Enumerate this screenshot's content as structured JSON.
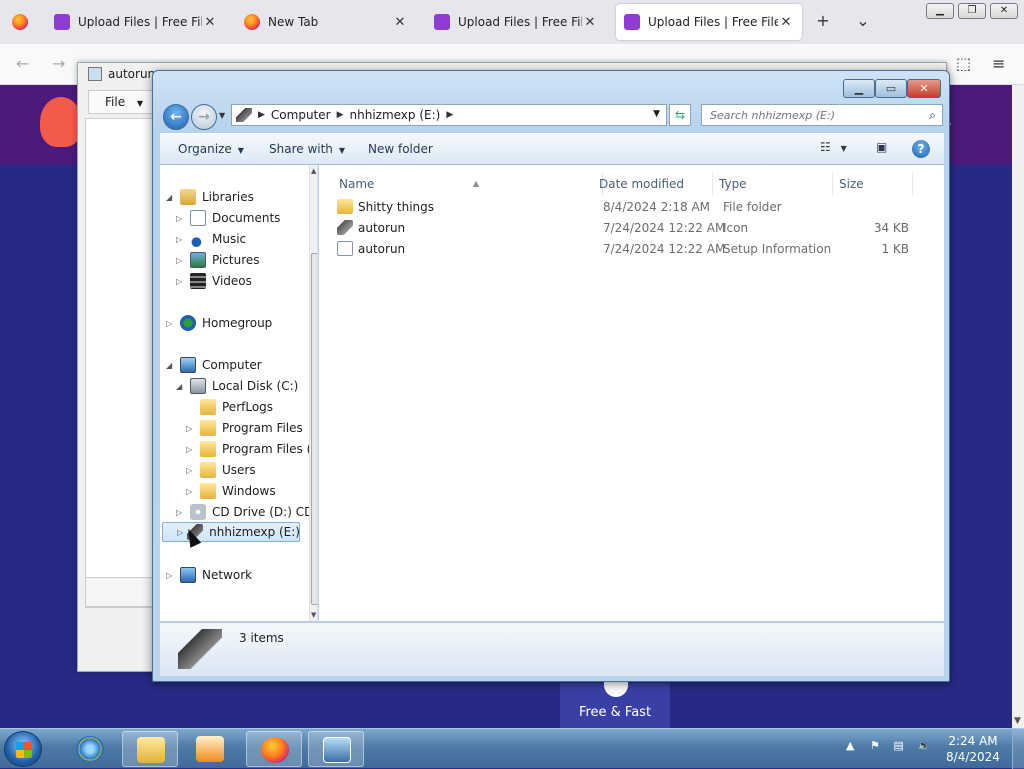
{
  "browser": {
    "tabs": [
      {
        "label": "Upload Files | Free File Up",
        "favicon": "upload-site"
      },
      {
        "label": "New Tab",
        "favicon": "firefox"
      },
      {
        "label": "Upload Files | Free File Up",
        "favicon": "upload-site"
      },
      {
        "label": "Upload Files | Free File Up",
        "favicon": "upload-site",
        "active": true
      }
    ],
    "new_tab_glyph": "+",
    "list_tabs_glyph": "⌄",
    "close_glyph": "✕"
  },
  "site": {
    "tagline": "Free & Fast",
    "edge_char": "r"
  },
  "background_dialog": {
    "title": "autorun",
    "menu_file": "File"
  },
  "explorer": {
    "address": {
      "segments": [
        "Computer",
        "nhhizmexp (E:)"
      ]
    },
    "search": {
      "placeholder": "Search nhhizmexp (E:)"
    },
    "commands": {
      "organize": "Organize",
      "share_with": "Share with",
      "new_folder": "New folder"
    },
    "nav": {
      "libraries": "Libraries",
      "documents": "Documents",
      "music": "Music",
      "pictures": "Pictures",
      "videos": "Videos",
      "homegroup": "Homegroup",
      "computer": "Computer",
      "local_disk": "Local Disk (C:)",
      "perflogs": "PerfLogs",
      "program_files": "Program Files",
      "program_files_x86": "Program Files (",
      "users": "Users",
      "windows": "Windows",
      "cd_drive": "CD Drive (D:) CDR",
      "usb_drive": "nhhizmexp (E:)",
      "network": "Network"
    },
    "columns": {
      "name": "Name",
      "date_modified": "Date modified",
      "type": "Type",
      "size": "Size"
    },
    "files": [
      {
        "name": "Shitty things",
        "date": "8/4/2024 2:18 AM",
        "type": "File folder",
        "size": "",
        "icon": "folder-icon"
      },
      {
        "name": "autorun",
        "date": "7/24/2024 12:22 AM",
        "type": "Icon",
        "size": "34 KB",
        "icon": "usb-drive-icon"
      },
      {
        "name": "autorun",
        "date": "7/24/2024 12:22 AM",
        "type": "Setup Information",
        "size": "1 KB",
        "icon": "setup-file-icon"
      }
    ],
    "status": {
      "item_count": "3 items"
    }
  },
  "taskbar": {
    "clock_time": "2:24 AM",
    "clock_date": "8/4/2024"
  }
}
